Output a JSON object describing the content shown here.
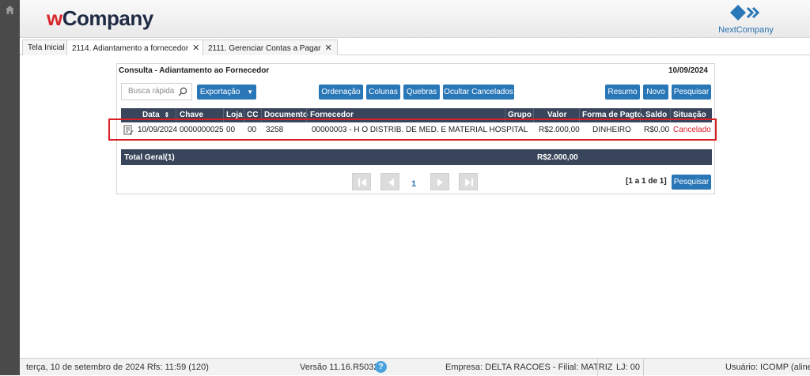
{
  "header": {
    "logo_w": "w",
    "logo_rest": "Company",
    "brand_right": "NextCompany"
  },
  "tabs": [
    {
      "label": "Tela Inicial"
    },
    {
      "label": "2114. Adiantamento a fornecedor"
    },
    {
      "label": "2111. Gerenciar Contas a Pagar"
    }
  ],
  "panel": {
    "title": "Consulta - Adiantamento ao Fornecedor",
    "date": "10/09/2024",
    "search_placeholder": "Busca rápida",
    "toolbar": {
      "exportacao": "Exportação",
      "ordenacao": "Ordenação",
      "colunas": "Colunas",
      "quebras": "Quebras",
      "ocultar_cancelados": "Ocultar Cancelados",
      "resumo": "Resumo",
      "novo": "Novo",
      "pesquisar": "Pesquisar"
    },
    "columns": [
      "Data",
      "Chave",
      "Loja",
      "CC",
      "Documento",
      "Fornecedor",
      "Grupo",
      "Valor",
      "Forma de Pagto.",
      "Saldo",
      "Situação"
    ],
    "rows": [
      {
        "data": "10/09/2024",
        "chave": "0000000025",
        "loja": "00",
        "cc": "00",
        "documento": "3258",
        "fornecedor": "00000003 - H O DISTRIB. DE MED. E MATERIAL HOSPITAL",
        "grupo": "",
        "valor": "R$2.000,00",
        "forma": "DINHEIRO",
        "saldo": "R$0,00",
        "situacao": "Cancelado"
      }
    ],
    "total_label": "Total Geral(1)",
    "total_value": "R$2.000,00",
    "pager": {
      "page": "1",
      "info": "[1 a 1 de 1]",
      "pesquisar": "Pesquisar"
    }
  },
  "footer": {
    "date": "terça, 10 de setembro de 2024  Rfs: 11:59 (120)",
    "version": "Versão 11.16.R5032",
    "help": "?",
    "empresa": "Empresa: DELTA RACOES - Filial: MATRIZ",
    "lj": "LJ: 00",
    "usuario": "Usuário: ICOMP (aline)"
  },
  "colors": {
    "primary_button": "#2a77b8",
    "grid_header": "#39455a",
    "cancelado": "#d81f26",
    "highlight": "#d81f26"
  }
}
